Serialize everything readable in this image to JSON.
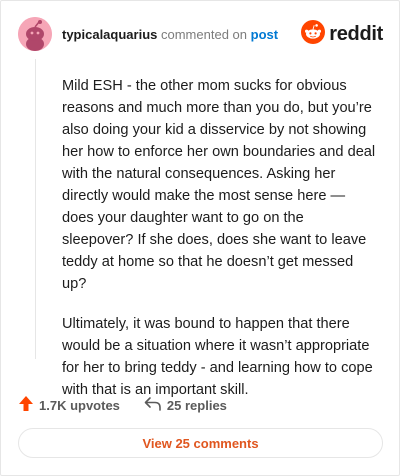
{
  "header": {
    "username": "typicalaquarius",
    "action_text": "commented on",
    "post_link": "post",
    "brand_name": "reddit"
  },
  "comment": {
    "paragraphs": [
      "Mild ESH - the other mom sucks for obvious reasons and much more than you do, but you’re also doing your kid a disservice by not showing her how to enforce her own boundaries and deal with the natural consequences. Asking her directly would make the most sense here — does your daughter want to go on the sleepover? If she does, does she want to leave teddy at home so that he doesn’t get messed up?",
      "Ultimately, it was bound to happen that there would be a situation where it wasn’t appropriate for her to bring teddy - and learning how to cope with that is an important skill."
    ]
  },
  "stats": {
    "upvotes": "1.7K upvotes",
    "replies": "25 replies"
  },
  "footer": {
    "view_button": "View 25 comments"
  },
  "colors": {
    "brand": "#ff4500",
    "link": "#0079d3",
    "view_button_text": "#e0561f",
    "avatar_bg": "#f6a6b7"
  },
  "icons": {
    "avatar": "snoo-avatar-icon",
    "brand": "reddit-logo-icon",
    "upvote": "upvote-arrow-icon",
    "reply": "reply-arrow-icon"
  }
}
